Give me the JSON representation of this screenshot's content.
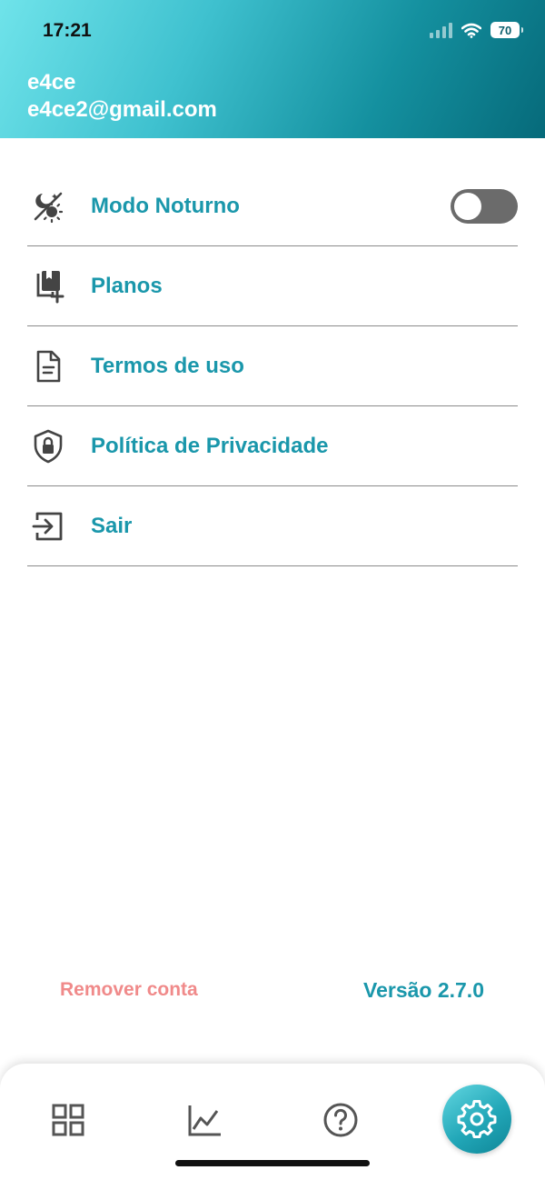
{
  "status_bar": {
    "time": "17:21",
    "battery": "70"
  },
  "user": {
    "name": "e4ce",
    "email": "e4ce2@gmail.com"
  },
  "menu": {
    "items": [
      {
        "label": "Modo Noturno",
        "icon": "night-mode-icon",
        "toggle_on": false
      },
      {
        "label": "Planos",
        "icon": "plans-icon"
      },
      {
        "label": "Termos de uso",
        "icon": "document-icon"
      },
      {
        "label": "Política de Privacidade",
        "icon": "shield-lock-icon"
      },
      {
        "label": "Sair",
        "icon": "logout-icon"
      }
    ]
  },
  "footer": {
    "remove_account": "Remover conta",
    "version": "Versão 2.7.0"
  },
  "bottom_nav": {
    "items": [
      "grid-icon",
      "chart-icon",
      "help-icon",
      "settings-icon"
    ],
    "active": "settings-icon"
  },
  "colors": {
    "accent": "#1a97ab",
    "danger": "#f08a8a",
    "header_start": "#6fe3ea",
    "header_end": "#066a7a"
  }
}
